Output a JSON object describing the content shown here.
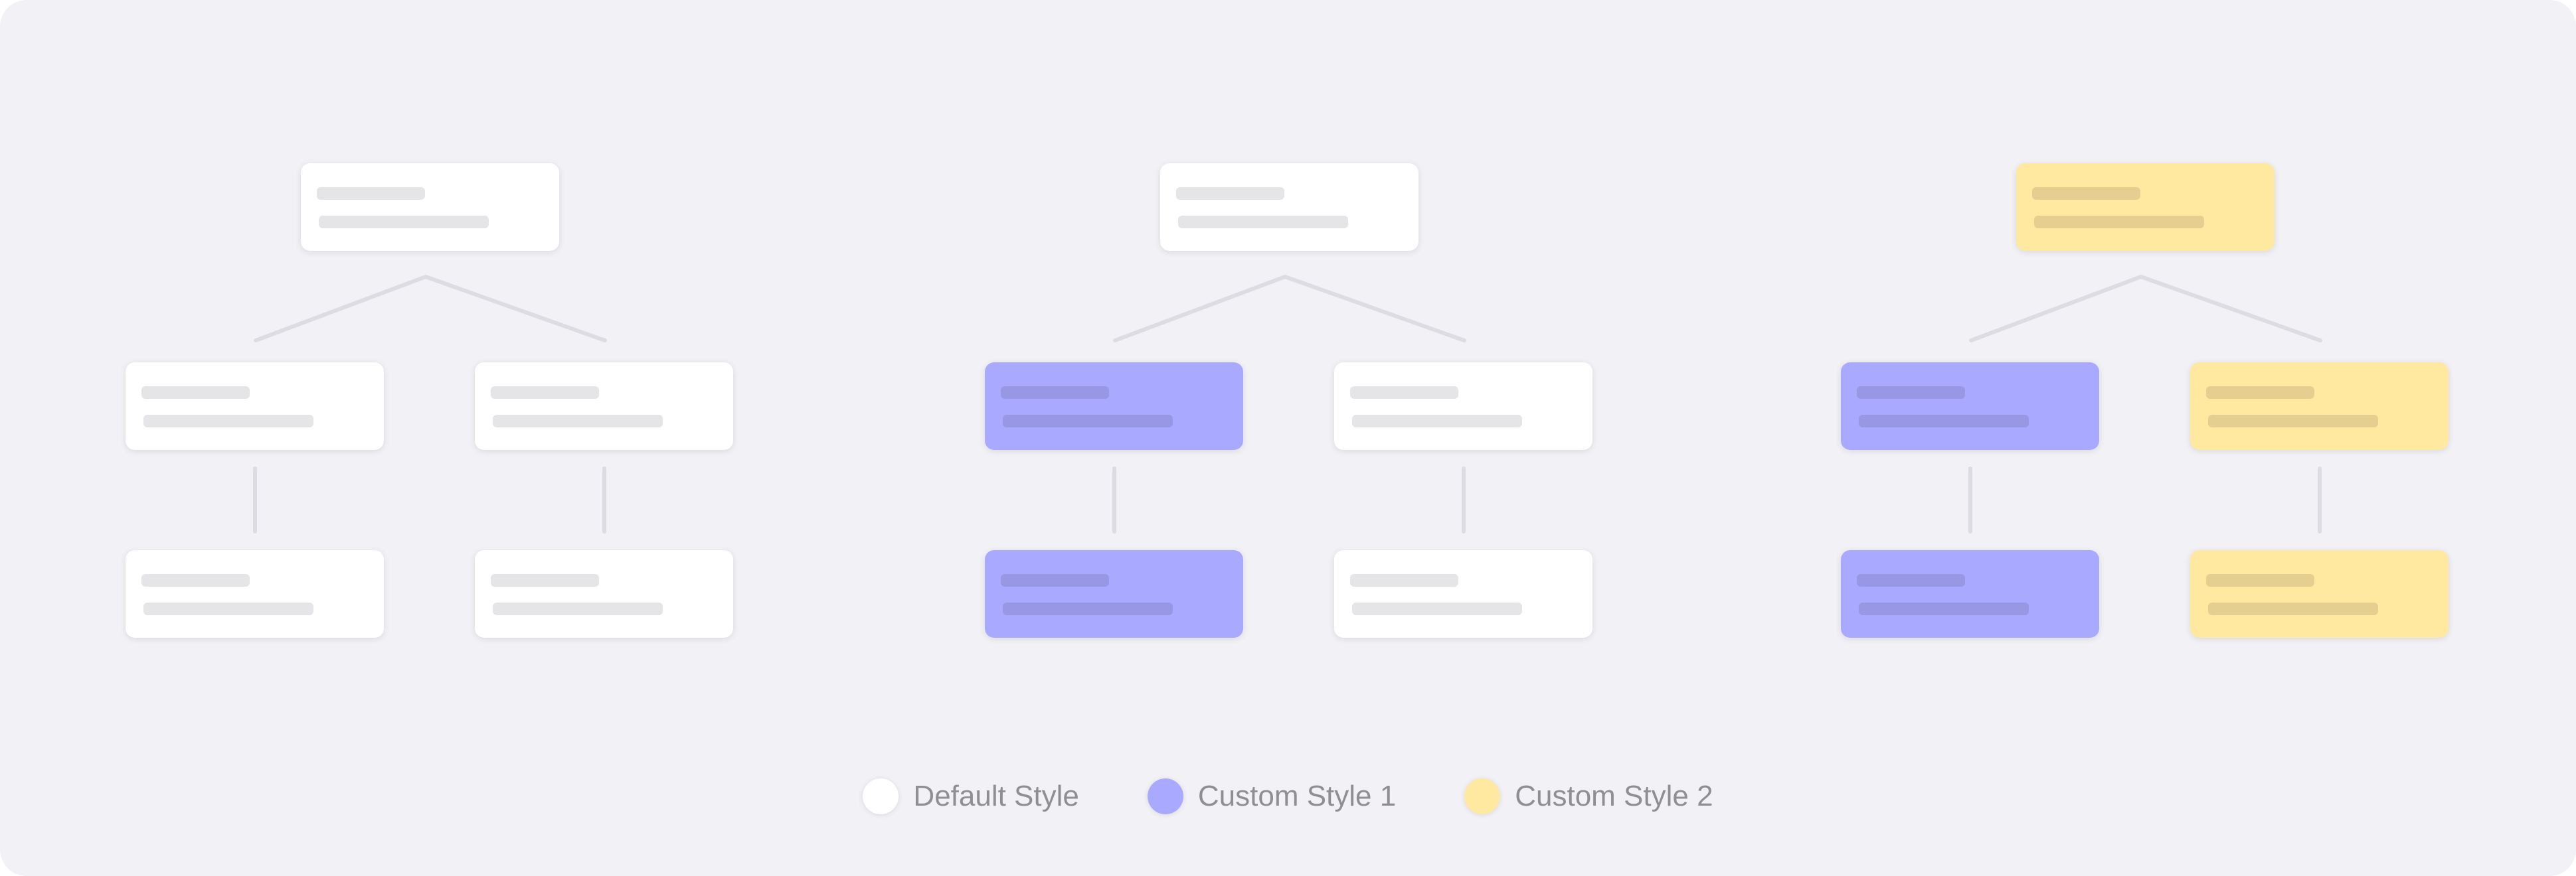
{
  "trees": [
    {
      "top": "default",
      "left_child": "default",
      "right_child": "default",
      "left_grandchild": "default",
      "right_grandchild": "default"
    },
    {
      "top": "default",
      "left_child": "custom1",
      "right_child": "default",
      "left_grandchild": "custom1",
      "right_grandchild": "default"
    },
    {
      "top": "custom2",
      "left_child": "custom1",
      "right_child": "custom2",
      "left_grandchild": "custom1",
      "right_grandchild": "custom2"
    }
  ],
  "styles": {
    "default": {
      "fill": "#FFFFFF",
      "bar": "#E5E5E7"
    },
    "custom1": {
      "fill": "#A9A9FF",
      "bar": "#9797E3"
    },
    "custom2": {
      "fill": "#FFE8A0",
      "bar": "#E5CF90"
    }
  },
  "legend": [
    {
      "style": "default",
      "label": "Default Style",
      "color": "#FFFFFF"
    },
    {
      "style": "custom1",
      "label": "Custom Style 1",
      "color": "#A9A9FF"
    },
    {
      "style": "custom2",
      "label": "Custom Style 2",
      "color": "#FFE8A0"
    }
  ],
  "colors": {
    "background": "#F2F2F6",
    "connector": "#DCDCE2",
    "legend_text": "#8E8E93"
  }
}
